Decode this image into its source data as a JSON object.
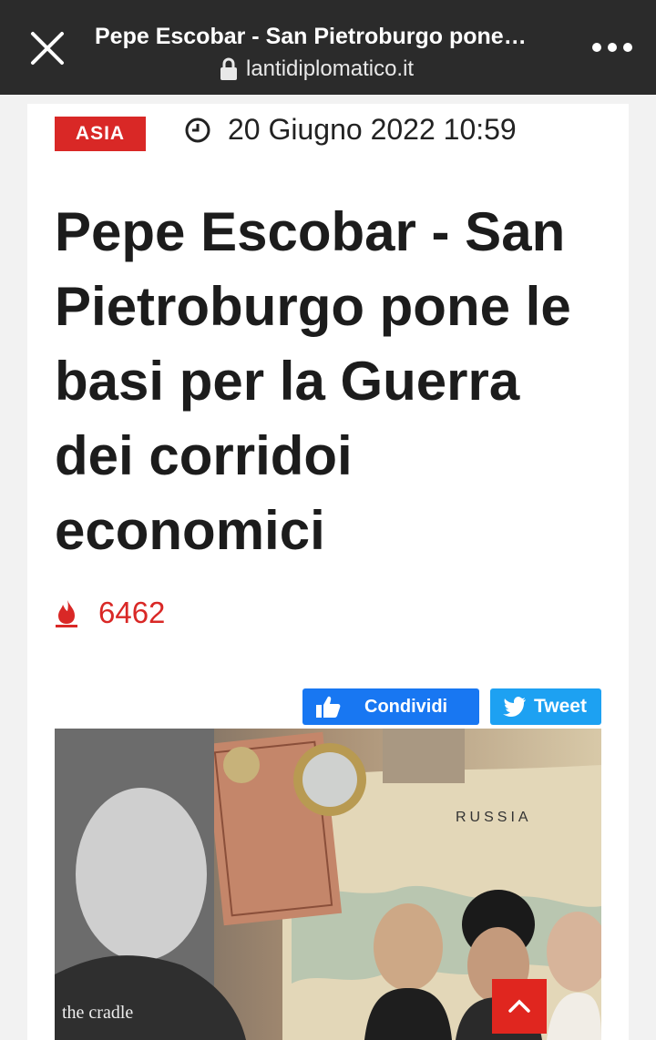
{
  "browser": {
    "title": "Pepe Escobar - San Pietroburgo pone…",
    "url": "lantidiplomatico.it"
  },
  "article": {
    "category": "ASIA",
    "date": "20 Giugno 2022 10:59",
    "headline": "Pepe Escobar - San Pietroburgo pone le basi per la Guerra dei corridoi economici",
    "views": "6462"
  },
  "share": {
    "facebook_label": "Condividi",
    "twitter_label": "Tweet"
  },
  "image": {
    "map_label": "RUSSIA",
    "watermark": "the cradle"
  },
  "colors": {
    "accent": "#d92826",
    "facebook": "#1877f2",
    "twitter": "#1da1f2",
    "topbar": "#2b2b2b"
  }
}
